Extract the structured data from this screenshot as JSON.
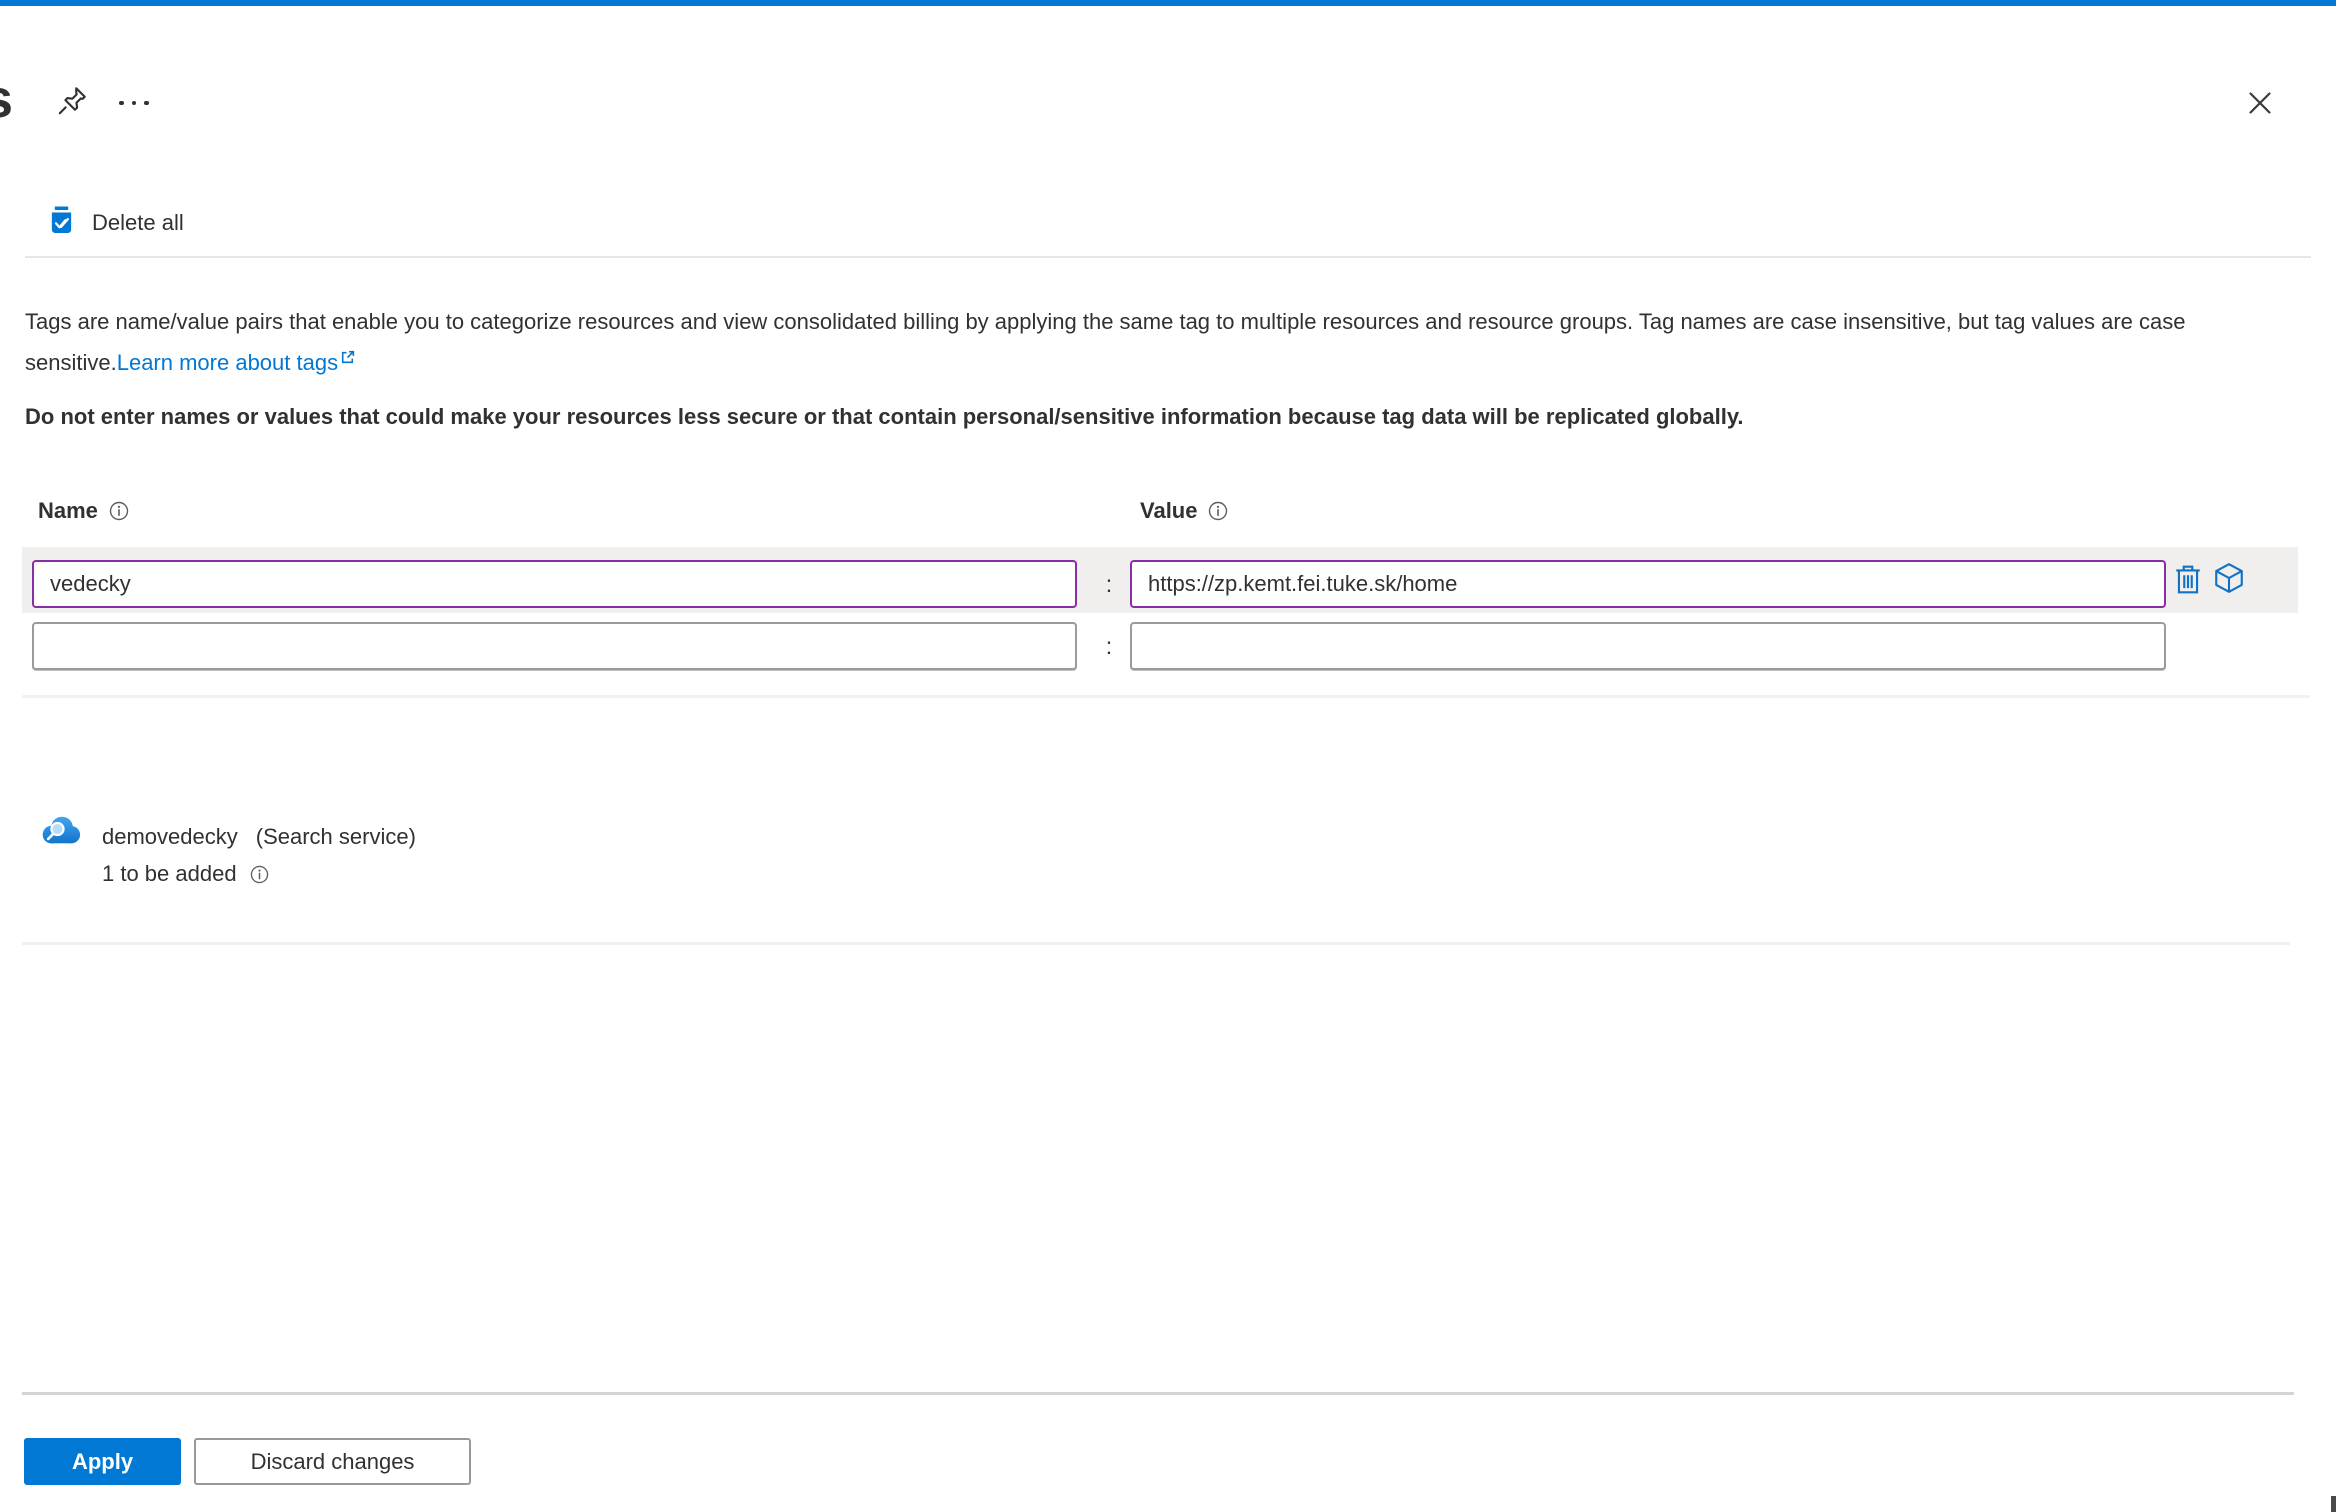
{
  "header": {
    "title_visible": "s"
  },
  "toolbar": {
    "delete_all": "Delete all"
  },
  "description": {
    "body": "Tags are name/value pairs that enable you to categorize resources and view consolidated billing by applying the same tag to multiple resources and resource groups. Tag names are case insensitive, but tag values are case sensitive.",
    "link": "Learn more about tags",
    "warning": "Do not enter names or values that could make your resources less secure or that contain personal/sensitive information because tag data will be replicated globally."
  },
  "form": {
    "name_label": "Name",
    "value_label": "Value",
    "separator": ":",
    "rows": [
      {
        "name": "vedecky",
        "value": "https://zp.kemt.fei.tuke.sk/home"
      },
      {
        "name": "",
        "value": ""
      }
    ]
  },
  "resource": {
    "name": "demovedecky",
    "type": "(Search service)",
    "status": "1 to be added"
  },
  "footer": {
    "apply": "Apply",
    "discard": "Discard changes"
  },
  "icons": {
    "pin": "pushpin-outline",
    "more": "ellipsis-horizontal",
    "close": "x-cross",
    "delete_all": "blue-trash-with-check",
    "info": "circled-i",
    "external_link": "box-with-arrow",
    "row_delete": "trash-outline",
    "row_cube": "cube-outline",
    "resource": "cloud-magnifier-search-service"
  },
  "colors": {
    "accent": "#0078d4",
    "modified_field_border": "#8a2da5",
    "text": "#323130",
    "row_highlight": "#f0efee"
  }
}
